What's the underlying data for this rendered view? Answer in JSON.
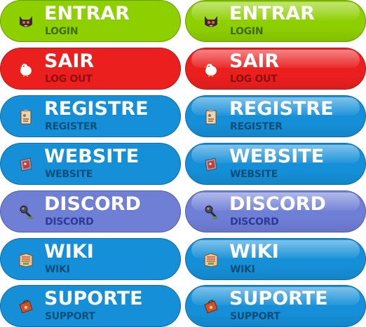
{
  "buttons": [
    {
      "id": "entrar",
      "title": "ENTRAR",
      "sub": "LOGIN",
      "icon": "cat-mask-icon",
      "color": "#8ecf00",
      "sub_color": "#3f6d00"
    },
    {
      "id": "sair",
      "title": "SAIR",
      "sub": "LOG OUT",
      "icon": "chicken-icon",
      "color": "#ec1f1f",
      "sub_color": "#8f0f0f"
    },
    {
      "id": "registre",
      "title": "REGISTRE",
      "sub": "REGISTER",
      "icon": "clipboard-icon",
      "color": "#1590d8",
      "sub_color": "#0a4f7a"
    },
    {
      "id": "website",
      "title": "WEBSITE",
      "sub": "WEBSITE",
      "icon": "picture-frame-icon",
      "color": "#1590d8",
      "sub_color": "#0a4f7a"
    },
    {
      "id": "discord",
      "title": "DISCORD",
      "sub": "DISCORD",
      "icon": "microphone-icon",
      "color": "#6f7fd6",
      "sub_color": "#2f3a9c"
    },
    {
      "id": "wiki",
      "title": "WIKI",
      "sub": "WIKI",
      "icon": "map-icon",
      "color": "#1590d8",
      "sub_color": "#0a4f7a"
    },
    {
      "id": "suporte",
      "title": "SUPORTE",
      "sub": "SUPPORT",
      "icon": "toolbox-icon",
      "color": "#1590d8",
      "sub_color": "#0a4f7a"
    }
  ]
}
